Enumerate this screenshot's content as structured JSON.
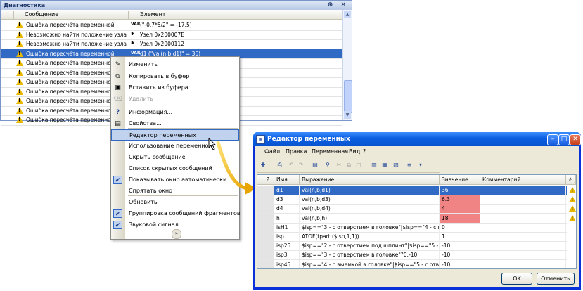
{
  "diagnostics": {
    "title": "Диагностика",
    "title_buttons": "⊕ ✕",
    "col_message": "Сообщение",
    "col_element": "Элемент",
    "rows": [
      {
        "message": "Ошибка пересчёта переменной",
        "icon": "VAR",
        "element": "(\"-0.7*5/2\" = -17.5)",
        "selected": false
      },
      {
        "message": "Невозможно найти положение узла",
        "icon": "node-icon",
        "element": "Узел 0x200007E",
        "selected": false
      },
      {
        "message": "Невозможно найти положение узла",
        "icon": "node-icon",
        "element": "Узел 0x2000112",
        "selected": false
      },
      {
        "message": "Ошибка пересчёта переменной",
        "icon": "VAR",
        "element": "d1 (\"val(n,b,d1)\" = 36)",
        "selected": true
      },
      {
        "message": "Ошибка пересчёта переменной",
        "icon": "",
        "element": "",
        "selected": false
      },
      {
        "message": "Ошибка пересчёта переменной",
        "icon": "",
        "element": "",
        "selected": false
      },
      {
        "message": "Ошибка пересчёта переменной",
        "icon": "",
        "element": "",
        "selected": false
      },
      {
        "message": "Ошибка пересчёта переменной",
        "icon": "",
        "element": "",
        "selected": false
      },
      {
        "message": "Ошибка пересчёта переменной",
        "icon": "",
        "element": "",
        "selected": false
      },
      {
        "message": "Ошибка пересчёта переменной",
        "icon": "",
        "element": "",
        "selected": false
      },
      {
        "message": "Ошибка пересчёта переменной",
        "icon": "",
        "element": "",
        "selected": false
      }
    ]
  },
  "context_menu": {
    "items": [
      {
        "label": "Изменить",
        "icon": "edit-icon",
        "disabled": false
      },
      {
        "label": "Копировать в буфер",
        "icon": "copy-icon",
        "disabled": false
      },
      {
        "label": "Вставить из буфера",
        "icon": "paste-icon",
        "disabled": false
      },
      {
        "label": "Удалить",
        "icon": "delete-icon",
        "disabled": true
      },
      {
        "label": "Информация...",
        "icon": "help-icon",
        "disabled": false
      },
      {
        "label": "Свойства...",
        "icon": "properties-icon",
        "disabled": false
      },
      {
        "label": "Редактор переменных",
        "icon": "",
        "disabled": false
      },
      {
        "label": "Использование переменной",
        "icon": "",
        "disabled": false
      },
      {
        "label": "Скрыть сообщение",
        "icon": "",
        "disabled": false
      },
      {
        "label": "Список скрытых сообщений",
        "icon": "",
        "disabled": false
      },
      {
        "label": "Показывать окно автоматически",
        "icon": "check-icon",
        "checked": true
      },
      {
        "label": "Спрятать окно",
        "icon": "",
        "disabled": false
      },
      {
        "label": "Обновить",
        "icon": "",
        "disabled": false
      },
      {
        "label": "Группировка сообщений фрагментов",
        "icon": "check-icon",
        "checked": true
      },
      {
        "label": "Звуковой сигнал",
        "icon": "check-icon",
        "checked": true
      }
    ],
    "more_icon": "»"
  },
  "variable_editor": {
    "title": "Редактор переменных",
    "title_icon": "▦",
    "menu": [
      "Файл",
      "Правка",
      "Переменная",
      "Вид",
      "?"
    ],
    "columns": [
      "",
      "?",
      "Имя",
      "Выражение",
      "Значение",
      "Комментарий",
      "⚠"
    ],
    "rows": [
      {
        "name": "d1",
        "expr": "val(n,b,d1)",
        "value": "36",
        "comment": "",
        "warn": true,
        "selected": true,
        "error": false
      },
      {
        "name": "d3",
        "expr": "val(n,b,d3)",
        "value": "6.3",
        "comment": "",
        "warn": true,
        "selected": false,
        "error": true
      },
      {
        "name": "d4",
        "expr": "val(n,b,d4)",
        "value": "4",
        "comment": "",
        "warn": true,
        "selected": false,
        "error": true
      },
      {
        "name": "h",
        "expr": "val(n,b,h)",
        "value": "18",
        "comment": "",
        "warn": true,
        "selected": false,
        "error": true
      },
      {
        "name": "isH1",
        "expr": "$isp==\"3 - с отверстием в головке\"|$isp==\"4 - с выем...",
        "value": "0",
        "comment": "",
        "warn": false,
        "selected": false,
        "error": false
      },
      {
        "name": "isp",
        "expr": "ATOF(tpart ($isp,1,1))",
        "value": "1",
        "comment": "",
        "warn": false,
        "selected": false,
        "error": false
      },
      {
        "name": "isp25",
        "expr": "$isp==\"2 - с отверстием под шплинт\"|$isp==\"5 - с отв...",
        "value": "-10",
        "comment": "",
        "warn": false,
        "selected": false,
        "error": false
      },
      {
        "name": "isp3",
        "expr": "$isp==\"3 - с отверстием в головке\"?0:-10",
        "value": "-10",
        "comment": "",
        "warn": false,
        "selected": false,
        "error": false
      },
      {
        "name": "isp45",
        "expr": "$isp==\"4 - с выемкой в головке\"|$isp==\"5 - с отверст...",
        "value": "-10",
        "comment": "",
        "warn": false,
        "selected": false,
        "error": false
      }
    ],
    "ok_label": "OK",
    "cancel_label": "Отменить"
  }
}
